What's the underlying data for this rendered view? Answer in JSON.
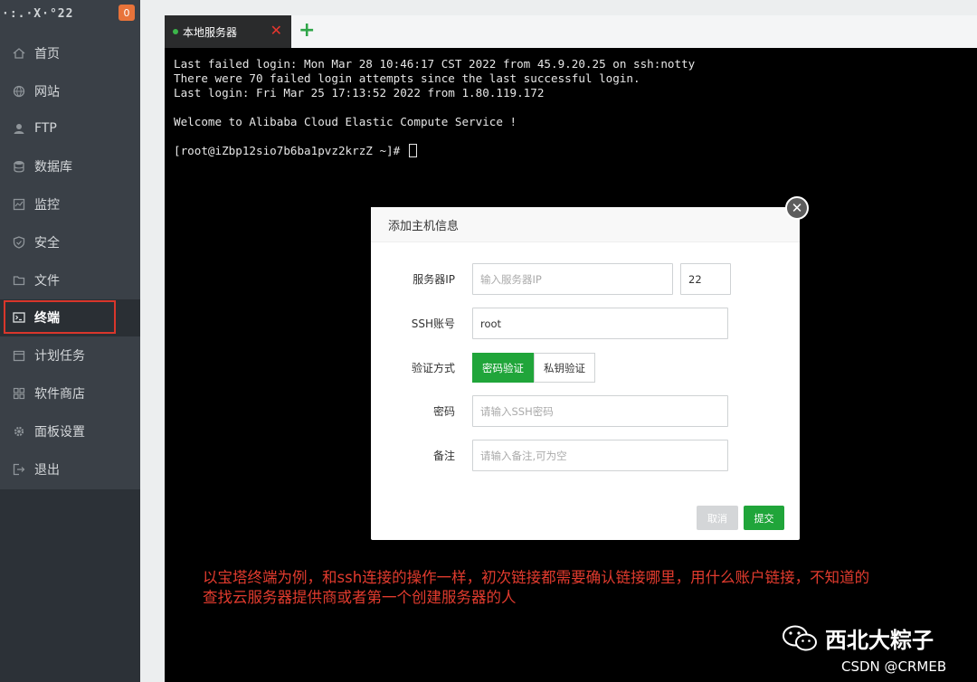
{
  "sidebar": {
    "server_ip": "·:.·X·°22",
    "notification_count": "0",
    "items": [
      {
        "label": "首页",
        "icon": "home-icon"
      },
      {
        "label": "网站",
        "icon": "globe-icon"
      },
      {
        "label": "FTP",
        "icon": "user-icon"
      },
      {
        "label": "数据库",
        "icon": "database-icon"
      },
      {
        "label": "监控",
        "icon": "monitor-icon"
      },
      {
        "label": "安全",
        "icon": "shield-icon"
      },
      {
        "label": "文件",
        "icon": "folder-icon"
      },
      {
        "label": "终端",
        "icon": "terminal-icon"
      },
      {
        "label": "计划任务",
        "icon": "calendar-icon"
      },
      {
        "label": "软件商店",
        "icon": "grid-icon"
      },
      {
        "label": "面板设置",
        "icon": "gear-icon"
      },
      {
        "label": "退出",
        "icon": "logout-icon"
      }
    ],
    "active_index": 7
  },
  "tabs": [
    {
      "label": "本地服务器"
    }
  ],
  "terminal": {
    "lines": [
      "Last failed login: Mon Mar 28 10:46:17 CST 2022 from 45.9.20.25 on ssh:notty",
      "There were 70 failed login attempts since the last successful login.",
      "Last login: Fri Mar 25 17:13:52 2022 from 1.80.119.172",
      "",
      "Welcome to Alibaba Cloud Elastic Compute Service !",
      "",
      "[root@iZbp12sio7b6ba1pvz2krzZ ~]# "
    ]
  },
  "modal": {
    "title": "添加主机信息",
    "server_ip_label": "服务器IP",
    "server_ip_placeholder": "输入服务器IP",
    "port_value": "22",
    "ssh_account_label": "SSH账号",
    "ssh_account_value": "root",
    "auth_label": "验证方式",
    "auth_password": "密码验证",
    "auth_key": "私钥验证",
    "password_label": "密码",
    "password_placeholder": "请输入SSH密码",
    "note_label": "备注",
    "note_placeholder": "请输入备注,可为空",
    "cancel_label": "取消",
    "submit_label": "提交"
  },
  "annotation": {
    "line1": "以宝塔终端为例，和ssh连接的操作一样，初次链接都需要确认链接哪里，用什么账户链接，不知道的",
    "line2": "查找云服务器提供商或者第一个创建服务器的人"
  },
  "watermark": {
    "account": "西北大粽子",
    "csdn": "CSDN @CRMEB"
  },
  "colors": {
    "sidebar_bg": "#3a4047",
    "accent_green": "#20a53a",
    "highlight_red": "#d9362b",
    "annotation_red": "#e23b2e",
    "badge_orange": "#e8733a"
  }
}
